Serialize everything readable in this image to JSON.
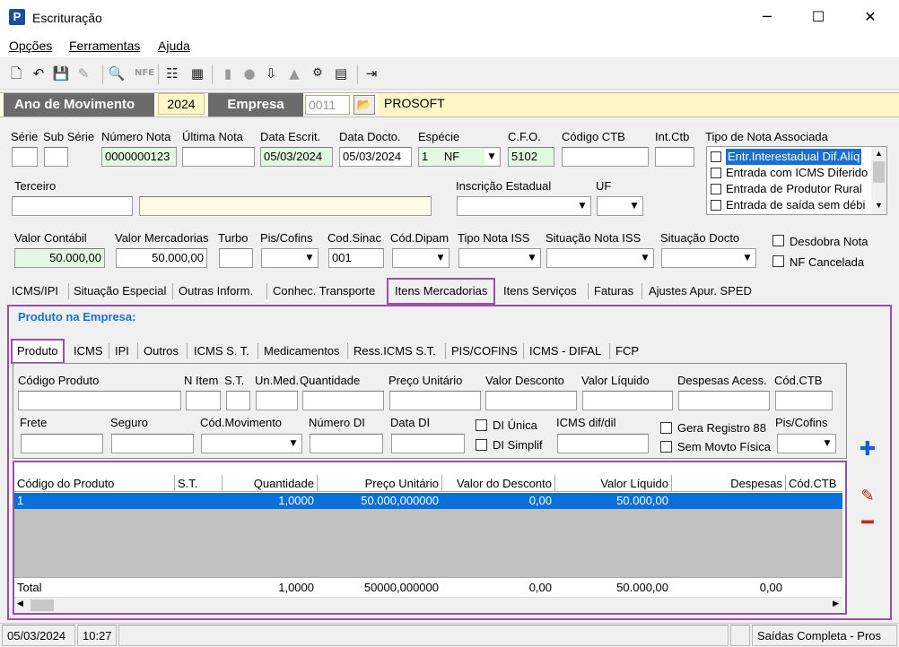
{
  "window": {
    "title": "Escrituração",
    "icon_letter": "P"
  },
  "menu": [
    "Opções",
    "Ferramentas",
    "Ajuda"
  ],
  "header": {
    "ano_label": "Ano de Movimento",
    "ano_value": "2024",
    "empresa_label": "Empresa",
    "empresa_code": "0011",
    "empresa_name": "PROSOFT"
  },
  "row1": {
    "serie": {
      "label": "Série",
      "value": ""
    },
    "sub_serie": {
      "label": "Sub Série",
      "value": ""
    },
    "numero_nota": {
      "label": "Número Nota",
      "value": "0000000123"
    },
    "ultima_nota": {
      "label": "Última Nota",
      "value": ""
    },
    "data_escrit": {
      "label": "Data Escrit.",
      "value": "05/03/2024"
    },
    "data_docto": {
      "label": "Data Docto.",
      "value": "05/03/2024"
    },
    "especie": {
      "label": "Espécie",
      "code": "1",
      "value": "NF"
    },
    "cfo": {
      "label": "C.F.O.",
      "value": "5102"
    },
    "codigo_ctb": {
      "label": "Código CTB",
      "value": ""
    },
    "int_ctb": {
      "label": "Int.Ctb",
      "value": ""
    },
    "tipo_nota": {
      "label": "Tipo de Nota Associada",
      "items": [
        "Entr.Interestadual Dif.Alíq",
        "Entrada com ICMS Diferido",
        "Entrada de Produtor Rural",
        "Entrada de saída sem débi"
      ]
    }
  },
  "row2": {
    "terceiro": {
      "label": "Terceiro"
    },
    "inscricao": {
      "label": "Inscrição Estadual"
    },
    "uf": {
      "label": "UF"
    }
  },
  "row3": {
    "valor_contabil": {
      "label": "Valor Contábil",
      "value": "50.000,00"
    },
    "valor_mercadorias": {
      "label": "Valor Mercadorias",
      "value": "50.000,00"
    },
    "turbo": {
      "label": "Turbo"
    },
    "pis_cofins": {
      "label": "Pis/Cofins"
    },
    "cod_sinac": {
      "label": "Cod.Sinac",
      "value": "001"
    },
    "cod_dipam": {
      "label": "Cód.Dipam"
    },
    "tipo_nota_iss": {
      "label": "Tipo Nota ISS"
    },
    "situacao_nota_iss": {
      "label": "Situação Nota ISS"
    },
    "situacao_docto": {
      "label": "Situação Docto"
    },
    "desdobra_nota": "Desdobra Nota",
    "nf_cancelada": "NF Cancelada"
  },
  "tabs": [
    "ICMS/IPI",
    "Situação Especial",
    "Outras Inform.",
    "Conhec. Transporte",
    "Itens Mercadorias",
    "Itens Serviços",
    "Faturas",
    "Ajustes Apur. SPED"
  ],
  "produto_title": "Produto na Empresa:",
  "subtabs": [
    "Produto",
    "ICMS",
    "IPI",
    "Outros",
    "ICMS S. T.",
    "Medicamentos",
    "Ress.ICMS S.T.",
    "PIS/COFINS",
    "ICMS - DIFAL",
    "FCP"
  ],
  "produto_fields": {
    "codigo_produto": "Código Produto",
    "n_item": "N Item",
    "st": "S.T.",
    "un_med": "Un.Med.",
    "quantidade": "Quantidade",
    "preco_unitario": "Preço Unitário",
    "valor_desconto": "Valor Desconto",
    "valor_liquido": "Valor Líquido",
    "despesas_acess": "Despesas Acess.",
    "cod_ctb": "Cód.CTB",
    "frete": "Frete",
    "seguro": "Seguro",
    "cod_movimento": "Cód.Movimento",
    "numero_di": "Número DI",
    "data_di": "Data DI",
    "di_unica": "DI Única",
    "di_simplif": "DI Simplif",
    "icms_dif_dil": "ICMS dif/dil",
    "gera_registro": "Gera Registro 88",
    "sem_movto": "Sem Movto Física",
    "pis_cofins": "Pis/Cofins"
  },
  "grid": {
    "columns": [
      "Código do Produto",
      "S.T.",
      "Quantidade",
      "Preço Unitário",
      "Valor do Desconto",
      "Valor Líquido",
      "Despesas",
      "Cód.CTB"
    ],
    "rows": [
      {
        "codigo": "1",
        "st": "",
        "quantidade": "1,0000",
        "preco": "50.000,000000",
        "desconto": "0,00",
        "liquido": "50.000,00",
        "despesas": "",
        "cod_ctb": ""
      }
    ],
    "total": {
      "label": "Total",
      "quantidade": "1,0000",
      "preco": "50000,000000",
      "desconto": "0,00",
      "liquido": "50.000,00",
      "despesas": "0,00"
    }
  },
  "status": {
    "date": "05/03/2024",
    "time": "10:27",
    "mode": "Saídas Completa - Pros"
  },
  "colors": {
    "accent_purple": "#9b4fa7",
    "selection_blue": "#0a6fd8",
    "title_blue": "#1a6fd3"
  }
}
